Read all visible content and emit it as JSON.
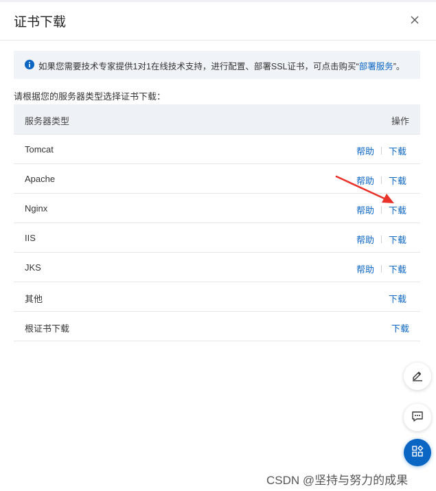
{
  "dialog": {
    "title": "证书下载"
  },
  "notice": {
    "text": "如果您需要技术专家提供1对1在线技术支持，进行配置、部署SSL证书，可点击购买“",
    "link": "部署服务",
    "suffix": "”。"
  },
  "prompt": "请根据您的服务器类型选择证书下载：",
  "table": {
    "col_type": "服务器类型",
    "col_action": "操作",
    "rows": [
      {
        "name": "Tomcat",
        "help": "帮助",
        "download": "下载"
      },
      {
        "name": "Apache",
        "help": "帮助",
        "download": "下载"
      },
      {
        "name": "Nginx",
        "help": "帮助",
        "download": "下载"
      },
      {
        "name": "IIS",
        "help": "帮助",
        "download": "下载"
      },
      {
        "name": "JKS",
        "help": "帮助",
        "download": "下载"
      },
      {
        "name": "其他",
        "download": "下载"
      },
      {
        "name": "根证书下载",
        "download": "下载"
      }
    ]
  },
  "watermark": "CSDN @坚持与努力的成果",
  "icons": {
    "close": "close-icon",
    "info": "info-icon",
    "edit": "edit-icon",
    "chat": "chat-icon",
    "apps": "apps-icon",
    "arrow": "red-arrow-annotation"
  },
  "colors": {
    "link": "#0b66c3",
    "header_bg": "#eef1f5",
    "notice_bg": "#f0f3f7",
    "arrow": "#e8322a"
  }
}
